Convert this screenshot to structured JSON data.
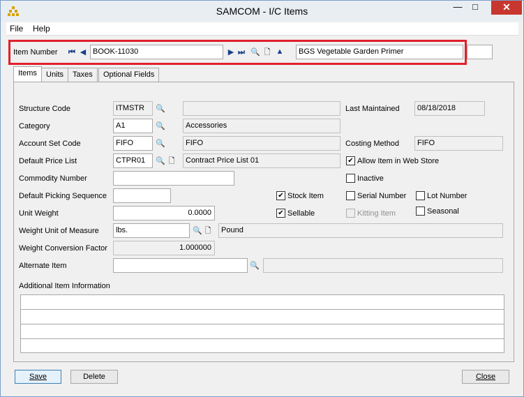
{
  "window": {
    "title": "SAMCOM - I/C Items",
    "controls": {
      "minimize": "—",
      "maximize": "□",
      "close": "✕"
    }
  },
  "menu": {
    "file": "File",
    "help": "Help"
  },
  "header": {
    "item_number_label": "Item Number",
    "item_number_value": "BOOK-11030",
    "item_description": "BGS Vegetable Garden Primer",
    "extra_field_value": ""
  },
  "tabs": [
    {
      "label": "Items",
      "active": true
    },
    {
      "label": "Units",
      "active": false
    },
    {
      "label": "Taxes",
      "active": false
    },
    {
      "label": "Optional Fields",
      "active": false
    }
  ],
  "form": {
    "structure_code": {
      "label": "Structure Code",
      "value": "ITMSTR",
      "desc": ""
    },
    "category": {
      "label": "Category",
      "value": "A1",
      "desc": "Accessories"
    },
    "account_set_code": {
      "label": "Account Set Code",
      "value": "FIFO",
      "desc": "FIFO"
    },
    "default_price_list": {
      "label": "Default Price List",
      "value": "CTPR01",
      "desc": "Contract Price List 01"
    },
    "commodity_number": {
      "label": "Commodity Number",
      "value": ""
    },
    "default_picking_sequence": {
      "label": "Default Picking Sequence",
      "value": ""
    },
    "unit_weight": {
      "label": "Unit Weight",
      "value": "0.0000"
    },
    "weight_unit_of_measure": {
      "label": "Weight Unit of Measure",
      "value": "lbs.",
      "desc": "Pound"
    },
    "weight_conversion_factor": {
      "label": "Weight Conversion Factor",
      "value": "1.000000"
    },
    "alternate_item": {
      "label": "Alternate Item",
      "value": "",
      "desc": ""
    },
    "additional_item_information": {
      "label": "Additional Item Information"
    },
    "last_maintained": {
      "label": "Last Maintained",
      "value": "08/18/2018"
    },
    "costing_method": {
      "label": "Costing Method",
      "value": "FIFO"
    }
  },
  "checkboxes": {
    "allow_item_in_web_store": {
      "label": "Allow Item in Web Store",
      "checked": true
    },
    "inactive": {
      "label": "Inactive",
      "checked": false
    },
    "stock_item": {
      "label": "Stock Item",
      "checked": true
    },
    "serial_number": {
      "label": "Serial Number",
      "checked": false
    },
    "lot_number": {
      "label": "Lot Number",
      "checked": false
    },
    "sellable": {
      "label": "Sellable",
      "checked": true
    },
    "kitting_item": {
      "label": "Kitting Item",
      "checked": false,
      "disabled": true
    },
    "seasonal": {
      "label": "Seasonal",
      "checked": false
    }
  },
  "buttons": {
    "save": "Save",
    "delete": "Delete",
    "close": "Close"
  },
  "colors": {
    "highlight_box": "#e0202a",
    "close_button": "#c7372f"
  }
}
